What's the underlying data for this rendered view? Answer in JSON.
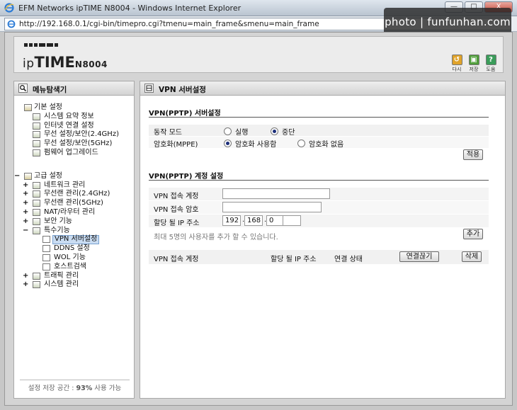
{
  "browser": {
    "window_title": "EFM Networks ipTIME N8004 - Windows Internet Explorer",
    "url": "http://192.168.0.1/cgi-bin/timepro.cgi?tmenu=main_frame&smenu=main_frame",
    "window_buttons": [
      "—",
      "□",
      "X"
    ]
  },
  "watermark": "photo | funfunhan.com",
  "header": {
    "brand_prefix": "ip",
    "brand_main": "TIME",
    "model": "N8004",
    "icons": [
      {
        "label": "다시",
        "glyph": "↺",
        "color": "#e0a32a",
        "icon": "refresh-icon"
      },
      {
        "label": "저장",
        "glyph": "▣",
        "color": "#4f9d3a",
        "icon": "save-icon"
      },
      {
        "label": "도움",
        "glyph": "?",
        "color": "#3a9d5a",
        "icon": "help-icon"
      }
    ]
  },
  "sidebar": {
    "title": "메뉴탐색기",
    "basic": {
      "label": "기본 설정",
      "items": [
        "시스템 요약 정보",
        "인터넷 연결 설정",
        "무선 설정/보안(2.4GHz)",
        "무선 설정/보안(5GHz)",
        "펌웨어 업그레이드"
      ]
    },
    "advanced": {
      "label": "고급 설정",
      "items": [
        {
          "label": "네트워크 관리",
          "toggle": "+"
        },
        {
          "label": "무선랜 관리(2.4GHz)",
          "toggle": "+"
        },
        {
          "label": "무선랜 관리(5GHz)",
          "toggle": "+"
        },
        {
          "label": "NAT/라우터 관리",
          "toggle": "+"
        },
        {
          "label": "보안 기능",
          "toggle": "+"
        },
        {
          "label": "특수기능",
          "toggle": "−"
        }
      ],
      "special": [
        "VPN 서버설정",
        "DDNS 설정",
        "WOL 기능",
        "호스트검색"
      ],
      "after": [
        {
          "label": "트래픽 관리",
          "toggle": "+"
        },
        {
          "label": "시스템 관리",
          "toggle": "+"
        }
      ],
      "toggle": "−"
    },
    "storage_prefix": "설정 저장 공간 : ",
    "storage_value": "93%",
    "storage_suffix": " 사용 가능"
  },
  "main": {
    "title": "VPN 서버설정",
    "server": {
      "heading": "VPN(PPTP) 서버설정",
      "mode_label": "동작 모드",
      "mode_options": [
        "실행",
        "중단"
      ],
      "mode_selected": 1,
      "enc_label": "암호화(MPPE)",
      "enc_options": [
        "암호화 사용함",
        "암호화 없음"
      ],
      "enc_selected": 0,
      "apply": "적용"
    },
    "account": {
      "heading": "VPN(PPTP) 계정 설정",
      "id_label": "VPN 접속 계정",
      "id_value": "",
      "pw_label": "VPN 접속 암호",
      "pw_value": "",
      "ip_label": "할당 될 IP 주소",
      "ip": [
        "192",
        "168",
        "0",
        ""
      ],
      "note": "최대 5명의 사용자를 추가 할 수 있습니다.",
      "add": "추가"
    },
    "table": {
      "columns": [
        "VPN 접속 계정",
        "할당 될 IP 주소",
        "연결 상태"
      ],
      "disconnect": "연결끊기",
      "delete": "삭제"
    }
  }
}
